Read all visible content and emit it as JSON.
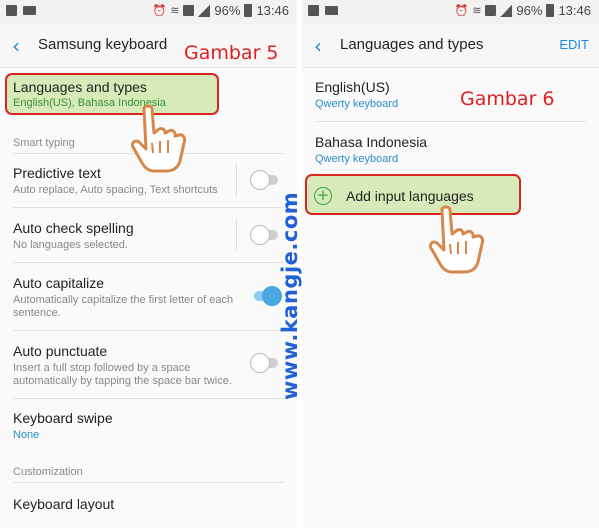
{
  "status_bar": {
    "battery": "96%",
    "time": "13:46"
  },
  "left": {
    "title": "Samsung keyboard",
    "caption": "Gambar 5",
    "items": [
      {
        "title": "Languages and types",
        "subtitle": "English(US), Bahasa Indonesia"
      },
      {
        "title": "Predictive text",
        "subtitle": "Auto replace, Auto spacing, Text shortcuts",
        "toggle": false
      },
      {
        "title": "Auto check spelling",
        "subtitle": "No languages selected.",
        "toggle": false
      },
      {
        "title": "Auto capitalize",
        "subtitle": "Automatically capitalize the first letter of each sentence.",
        "toggle": true
      },
      {
        "title": "Auto punctuate",
        "subtitle": "Insert a full stop followed by a space automatically by tapping the space bar twice.",
        "toggle": false
      },
      {
        "title": "Keyboard swipe",
        "subtitle": "None"
      },
      {
        "title": "Keyboard layout"
      }
    ],
    "sections": {
      "smart_typing": "Smart typing",
      "customization": "Customization"
    }
  },
  "right": {
    "title": "Languages and types",
    "edit": "EDIT",
    "caption": "Gambar 6",
    "languages": [
      {
        "title": "English(US)",
        "subtitle": "Qwerty keyboard"
      },
      {
        "title": "Bahasa Indonesia",
        "subtitle": "Qwerty keyboard"
      }
    ],
    "add_label": "Add input languages"
  },
  "watermark": "www.kangje.com",
  "colors": {
    "accent": "#1e88e5",
    "highlight_border": "#d9261c",
    "highlight_fill": "#d7eab9",
    "caption": "#e02020",
    "watermark": "#2060d8",
    "toggle_on": "#4aa9e3"
  },
  "icons": [
    "image-icon",
    "mail-icon",
    "alarm-icon",
    "wifi-icon",
    "sim-icon",
    "signal-icon",
    "battery-icon",
    "back-arrow-icon",
    "plus-circle-icon",
    "pointing-hand-icon"
  ]
}
